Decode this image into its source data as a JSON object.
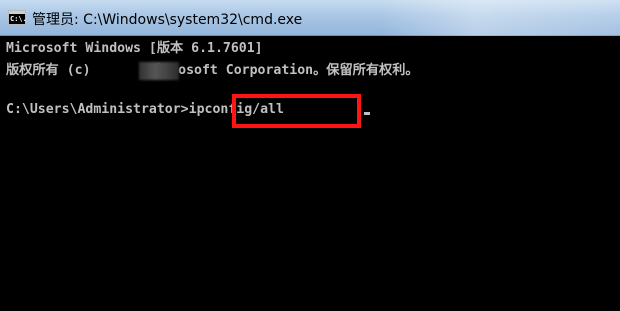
{
  "window": {
    "title": "管理员: C:\\Windows\\system32\\cmd.exe",
    "icon": "cmd-app-icon",
    "icon_text": "C:\\."
  },
  "console": {
    "line1": "Microsoft Windows [版本 6.1.7601]",
    "line2_prefix": "版权所有 (c) ",
    "line2_suffix": " Microsoft Corporation。保留所有权利。",
    "prompt": "C:\\Users\\Administrator>",
    "command": "ipconfig/all"
  },
  "colors": {
    "console_bg": "#000000",
    "console_text": "#c0c0c0",
    "highlight": "#ff1414",
    "titlebar": "#a9c6e6"
  }
}
